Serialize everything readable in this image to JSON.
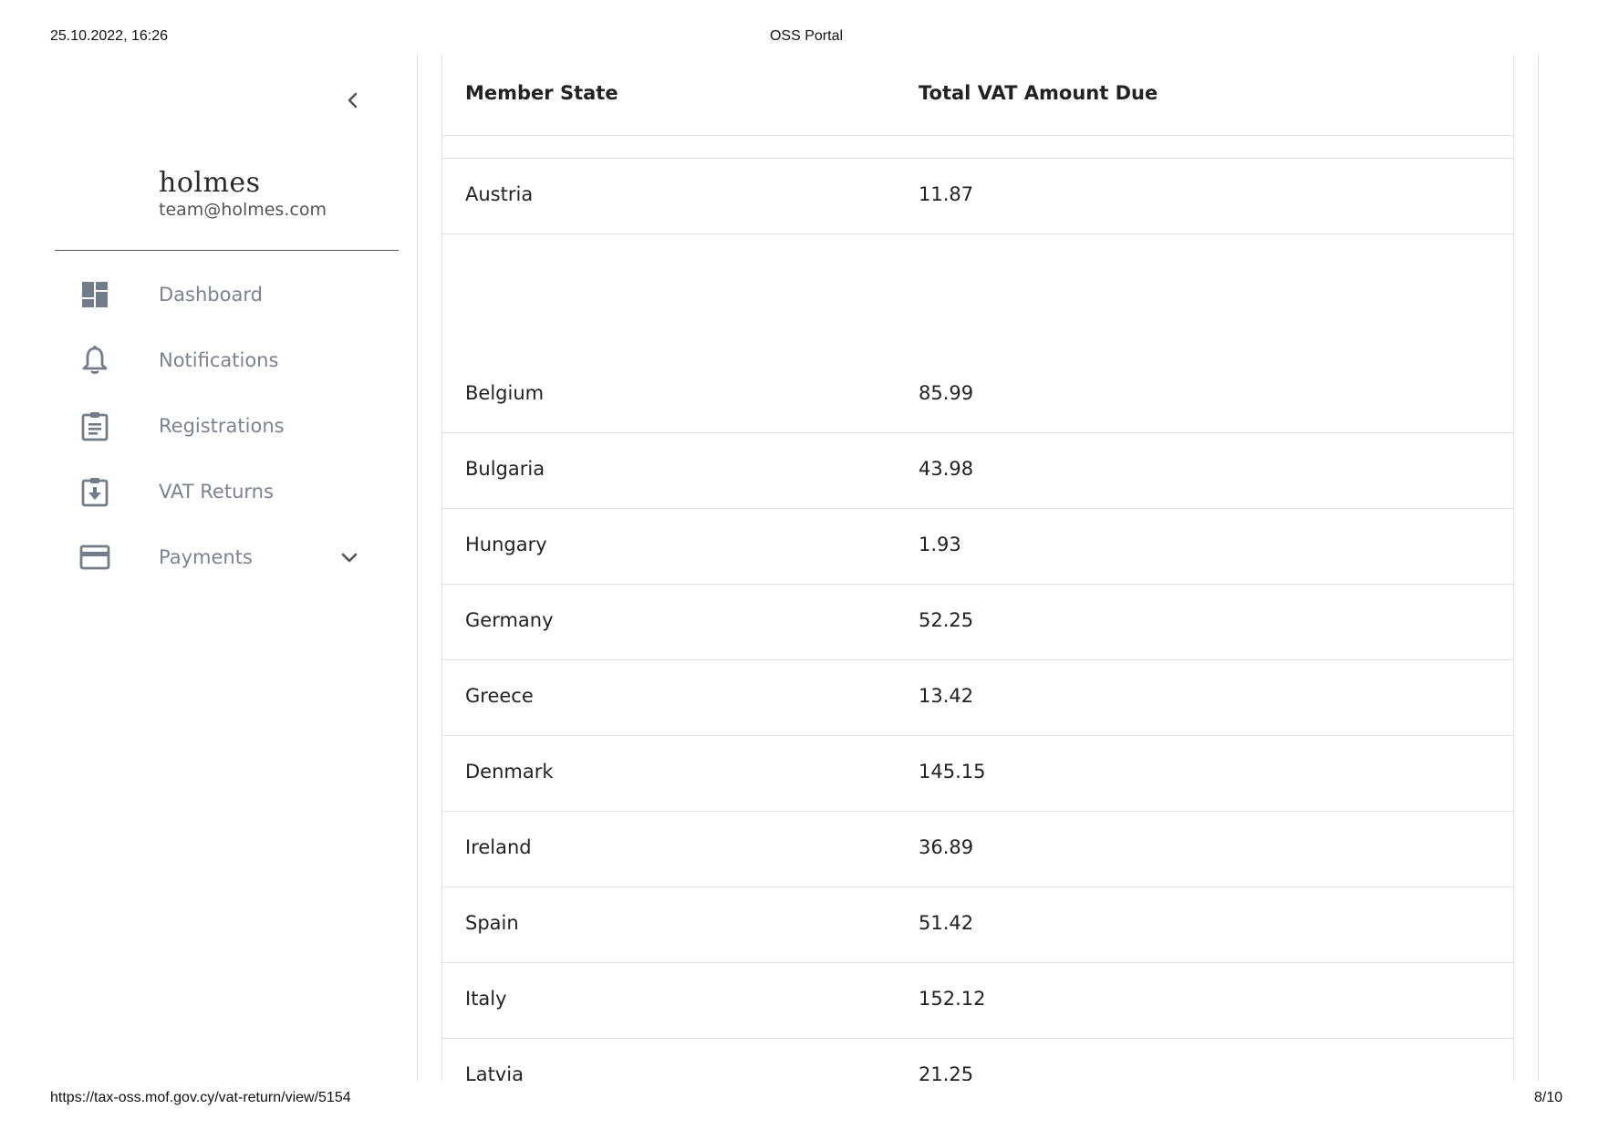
{
  "print_header": {
    "datetime": "25.10.2022, 16:26",
    "title": "OSS Portal"
  },
  "print_footer": {
    "url": "https://tax-oss.mof.gov.cy/vat-return/view/5154",
    "page": "8/10"
  },
  "sidebar": {
    "brand_name": "holmes",
    "brand_email": "team@holmes.com",
    "items": [
      {
        "label": "Dashboard",
        "icon": "dashboard-icon"
      },
      {
        "label": "Notifications",
        "icon": "bell-icon"
      },
      {
        "label": "Registrations",
        "icon": "clipboard-icon"
      },
      {
        "label": "VAT Returns",
        "icon": "clipboard-download-icon"
      },
      {
        "label": "Payments",
        "icon": "credit-card-icon",
        "expandable": true
      }
    ],
    "icon_color": "#737c89"
  },
  "table": {
    "headers": {
      "member_state": "Member State",
      "total_vat": "Total VAT Amount Due"
    },
    "rows": [
      {
        "member_state": "Austria",
        "total_vat": "11.87"
      },
      {
        "member_state": "Belgium",
        "total_vat": "85.99"
      },
      {
        "member_state": "Bulgaria",
        "total_vat": "43.98"
      },
      {
        "member_state": "Hungary",
        "total_vat": "1.93"
      },
      {
        "member_state": "Germany",
        "total_vat": "52.25"
      },
      {
        "member_state": "Greece",
        "total_vat": "13.42"
      },
      {
        "member_state": "Denmark",
        "total_vat": "145.15"
      },
      {
        "member_state": "Ireland",
        "total_vat": "36.89"
      },
      {
        "member_state": "Spain",
        "total_vat": "51.42"
      },
      {
        "member_state": "Italy",
        "total_vat": "152.12"
      },
      {
        "member_state": "Latvia",
        "total_vat": "21.25"
      }
    ]
  }
}
